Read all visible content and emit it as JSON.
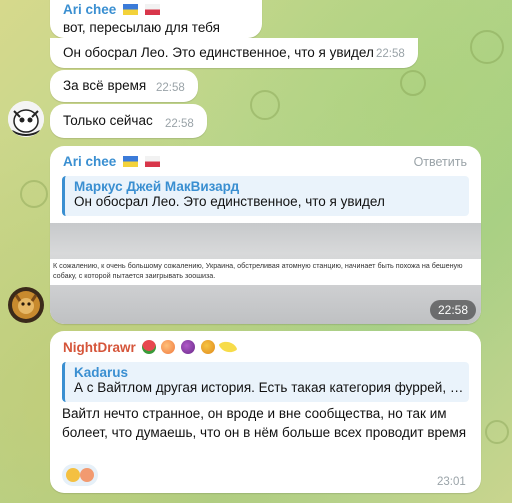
{
  "messages": {
    "m1": {
      "sender": "Ari chee",
      "text": "вот, пересылаю для тебя"
    },
    "m2": {
      "text": "Он обосрал Лео. Это единственное, что я увидел",
      "time": "22:58"
    },
    "m3": {
      "text": "За всё время",
      "time": "22:58"
    },
    "m4": {
      "text": "Только сейчас",
      "time": "22:58"
    },
    "m5": {
      "sender": "Ari chee",
      "reply_label": "Ответить",
      "quote_name": "Маркус Джей МакВизард",
      "quote_text": "Он обосрал Лео. Это единственное, что я увидел",
      "image_caption": "К сожалению, к очень большому сожалению, Украина, обстреливая атомную станцию, начинает быть похожа на бешеную собаку, с которой пытается заигрывать зоошиза.",
      "time": "22:58"
    },
    "m6": {
      "sender": "NightDrawr",
      "quote_name": "Kadarus",
      "quote_text": "А с Вайтлом другая история. Есть такая категория фуррей, ко...",
      "text": "Вайтл нечто странное, он вроде и вне сообщества, но так им болеет, что думаешь, что он в нём больше всех проводит время",
      "time": "23:01"
    }
  },
  "icons": {
    "flag1": "ukraine-flag-icon",
    "flag2": "poland-flag-icon",
    "reaction": "thumbs-up-and-peach-reaction",
    "fruit_emojis": [
      "watermelon",
      "peach",
      "grapes",
      "mango",
      "banana"
    ]
  },
  "colors": {
    "accent_blue": "#3a8fd1",
    "sender_red": "#d5553a",
    "bubble": "#ffffff"
  }
}
